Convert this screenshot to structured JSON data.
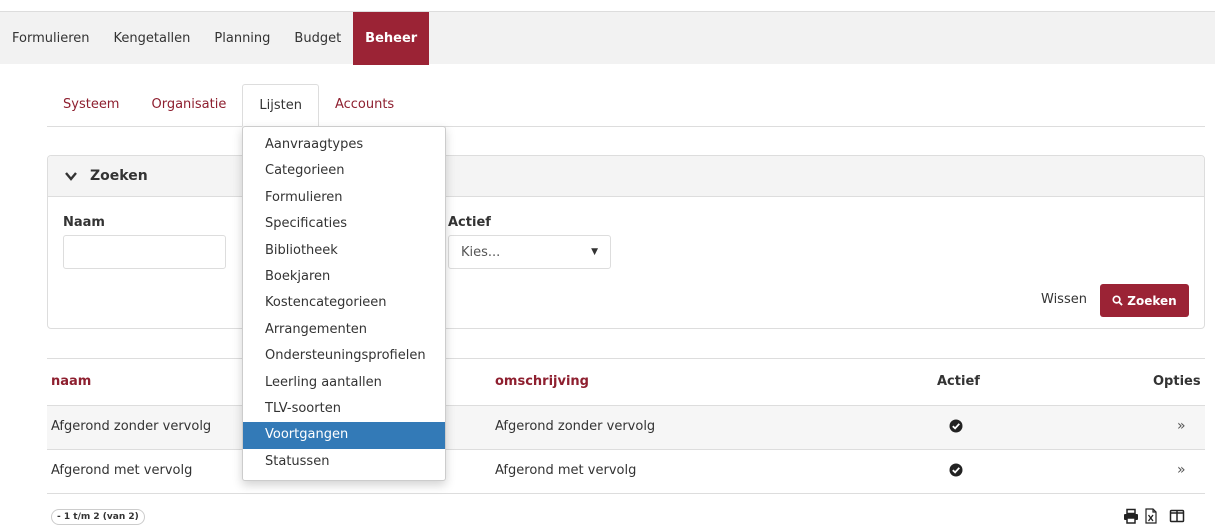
{
  "topnav": {
    "items": [
      "Formulieren",
      "Kengetallen",
      "Planning",
      "Budget",
      "Beheer"
    ],
    "active": "Beheer"
  },
  "subtabs": {
    "items": [
      "Systeem",
      "Organisatie",
      "Lijsten",
      "Accounts"
    ],
    "active": "Lijsten"
  },
  "search": {
    "title": "Zoeken",
    "naam_label": "Naam",
    "naam_value": "",
    "actief_label": "Actief",
    "actief_value": "Kies...",
    "clear_label": "Wissen",
    "submit_label": "Zoeken"
  },
  "dropdown": {
    "items": [
      "Aanvraagtypes",
      "Categorieen",
      "Formulieren",
      "Specificaties",
      "Bibliotheek",
      "Boekjaren",
      "Kostencategorieen",
      "Arrangementen",
      "Ondersteuningsprofielen",
      "Leerling aantallen",
      "TLV-soorten",
      "Voortgangen",
      "Statussen"
    ],
    "active": "Voortgangen"
  },
  "table": {
    "columns": {
      "naam": "naam",
      "omschrijving": "omschrijving",
      "actief": "Actief",
      "opties": "Opties"
    },
    "rows": [
      {
        "naam": "Afgerond zonder vervolg",
        "omschrijving": "Afgerond zonder vervolg",
        "actief": true,
        "option": "»"
      },
      {
        "naam": "Afgerond met vervolg",
        "omschrijving": "Afgerond met vervolg",
        "actief": true,
        "option": "»"
      }
    ]
  },
  "footer": {
    "pager": "- 1 t/m 2 (van 2)",
    "icons": [
      "print-icon",
      "excel-export-icon",
      "columns-icon"
    ]
  },
  "colors": {
    "brand": "#9b2335",
    "link": "#8e1f2f",
    "selected": "#337ab7"
  }
}
